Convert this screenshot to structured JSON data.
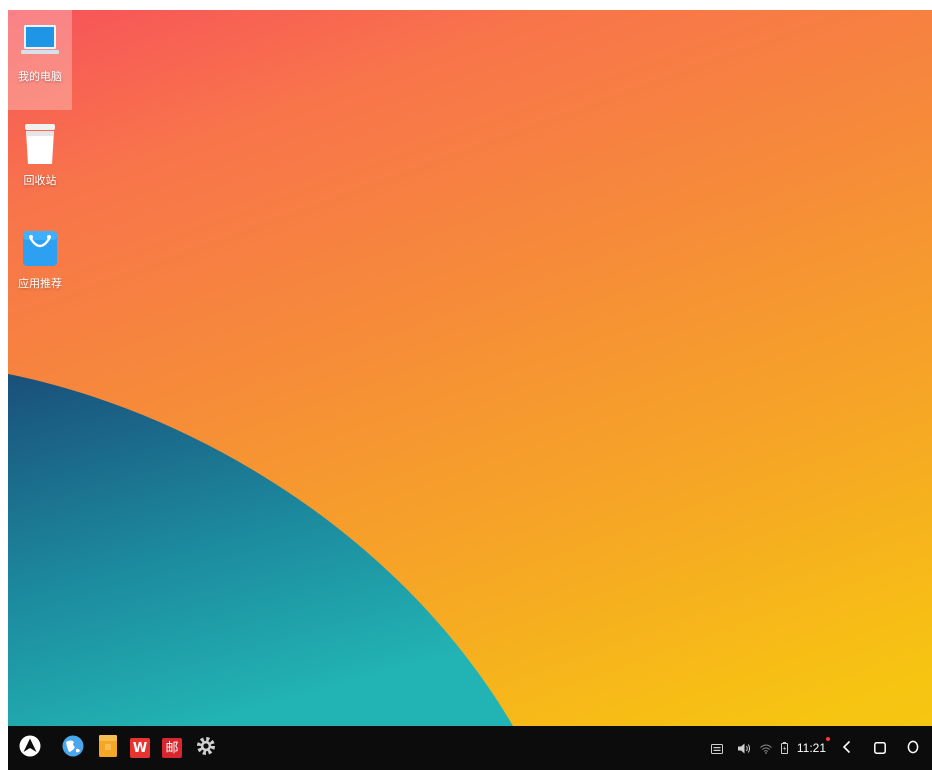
{
  "desktop": {
    "icons": [
      {
        "label": "我的电脑",
        "icon": "computer-icon",
        "selected": true
      },
      {
        "label": "回收站",
        "icon": "trash-icon",
        "selected": false
      },
      {
        "label": "应用推荐",
        "icon": "app-store-bag-icon",
        "selected": false
      }
    ]
  },
  "taskbar": {
    "start_icon": "start-menu-logo-icon",
    "apps": [
      {
        "name": "browser",
        "icon": "browser-globe-icon"
      },
      {
        "name": "files",
        "icon": "file-manager-icon"
      },
      {
        "name": "wps",
        "icon": "wps-office-icon",
        "glyph": "W"
      },
      {
        "name": "mail",
        "icon": "mail-app-icon",
        "glyph": "邮"
      },
      {
        "name": "settings",
        "icon": "settings-gear-icon"
      }
    ],
    "tray": {
      "keyboard_icon": "keyboard-icon",
      "volume_icon": "volume-icon",
      "wifi_icon": "wifi-icon",
      "battery_icon": "battery-icon",
      "time": "11:21",
      "notification_dot_color": "#ff3b30"
    },
    "nav": {
      "back_icon": "back-chevron-icon",
      "home_icon": "home-square-icon",
      "recents_icon": "recents-circle-icon"
    }
  },
  "colors": {
    "wallpaper_top": "#f7525a",
    "wallpaper_bottom": "#f5c812",
    "wave_dark": "#1a4f7a",
    "wave_light": "#22b4b4",
    "taskbar_bg": "#0c0c0c"
  }
}
